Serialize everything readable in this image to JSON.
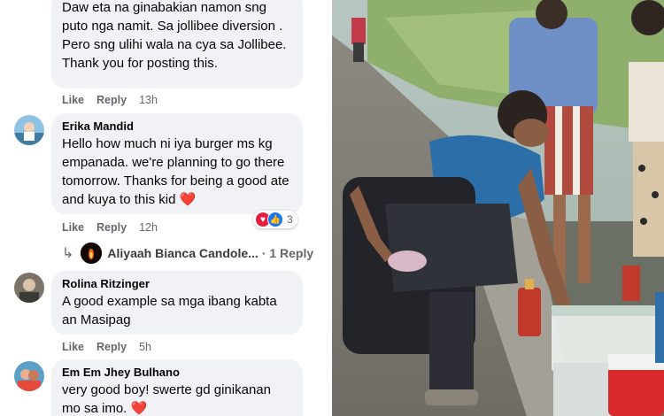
{
  "comments": [
    {
      "text": "Daw eta na ginabakian namon sng puto nga namit. Sa jollibee diversion . Pero sng ulihi wala na cya sa Jollibee. Thank you for posting this.",
      "like": "Like",
      "reply": "Reply",
      "time": "13h"
    },
    {
      "author": "Erika Mandid",
      "text": "Hello how much ni iya burger ms kg empanada. we're planning to go there tomorrow. Thanks for being a good ate and kuya to this kid",
      "emoji": "❤️",
      "like": "Like",
      "reply": "Reply",
      "time": "12h",
      "reaction_count": "3",
      "reply_thread": {
        "name": "Aliyaah Bianca Candole...",
        "count": "· 1 Reply"
      }
    },
    {
      "author": "Rolina Ritzinger",
      "text": "A good example sa mga ibang kabta an Masipag",
      "like": "Like",
      "reply": "Reply",
      "time": "5h"
    },
    {
      "author": "Em Em Jhey Bulhano",
      "text": "very good boy! swerte gd ginikanan mo sa imo.",
      "emoji": "❤️"
    }
  ],
  "colors": {
    "bubble": "#f0f2f5",
    "action_text": "#65676b",
    "heart": "#e41e3f",
    "like_blue": "#1877f2"
  }
}
